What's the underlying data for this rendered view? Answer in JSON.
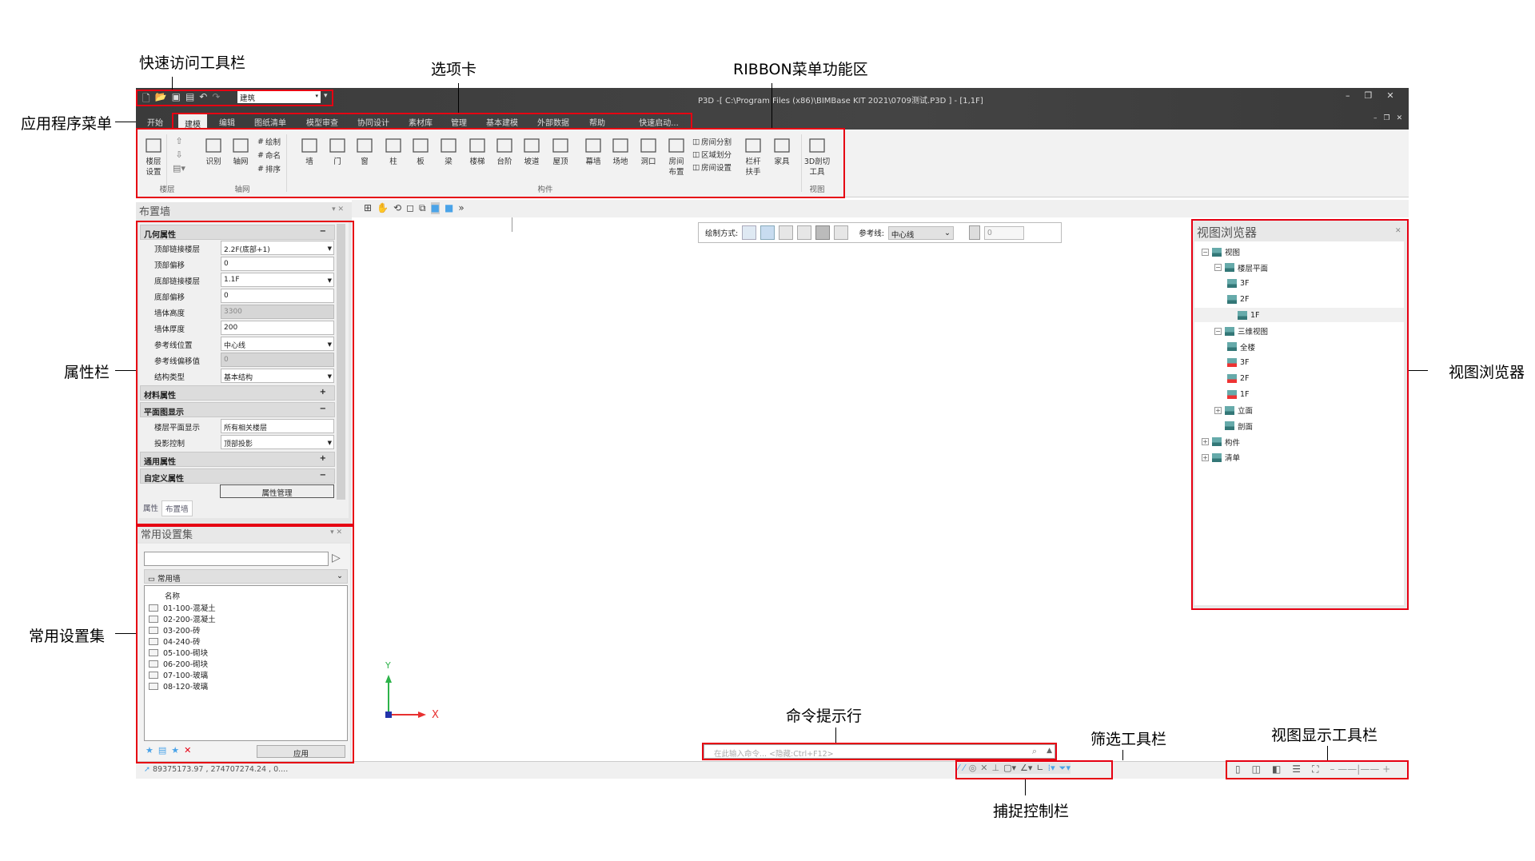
{
  "annotations": {
    "quick_access": "快速访问工具栏",
    "tabs": "选项卡",
    "ribbon": "RIBBON菜单功能区",
    "app_menu": "应用程序菜单",
    "property_bar": "属性栏",
    "common_settings": "常用设置集",
    "view_browser": "视图浏览器",
    "command_line": "命令提示行",
    "filter_toolbar": "筛选工具栏",
    "view_display_toolbar": "视图显示工具栏",
    "snap_bar": "捕捉控制栏"
  },
  "window": {
    "title": "P3D -[ C:\\Program Files (x86)\\BIMBase KIT 2021\\0709测试.P3D ] - [1,1F]",
    "discipline": "建筑"
  },
  "tabs": [
    {
      "label": "开始"
    },
    {
      "label": "建模",
      "active": true
    },
    {
      "label": "编辑"
    },
    {
      "label": "图纸清单"
    },
    {
      "label": "模型审查"
    },
    {
      "label": "协同设计"
    },
    {
      "label": "素材库"
    },
    {
      "label": "管理"
    },
    {
      "label": "基本建模"
    },
    {
      "label": "外部数据"
    },
    {
      "label": "帮助"
    },
    {
      "label": "快速启动..."
    }
  ],
  "ribbon": {
    "groups": [
      "楼层",
      "轴网",
      "构件",
      "视图"
    ],
    "floor": {
      "settings_1": "楼层",
      "settings_2": "设置"
    },
    "grid": {
      "identify": "识别",
      "grid": "轴网",
      "draw": "绘制",
      "name": "命名",
      "sort": "排序"
    },
    "components": [
      "墙",
      "门",
      "窗",
      "柱",
      "板",
      "梁",
      "楼梯",
      "台阶",
      "坡道",
      "屋顶",
      "幕墙",
      "场地",
      "洞口"
    ],
    "room_layout_1": "房间",
    "room_layout_2": "布置",
    "room_small": [
      "房间分割",
      "区域划分",
      "房间设置"
    ],
    "railing_1": "栏杆",
    "railing_2": "扶手",
    "furniture": "家具",
    "section_1": "3D剖切",
    "section_2": "工具"
  },
  "property_panel": {
    "title": "布置墙",
    "sections": {
      "geometry": "几何属性",
      "material": "材料属性",
      "plan": "平面图显示",
      "general": "通用属性",
      "custom": "自定义属性"
    },
    "geometry_rows": [
      {
        "label": "顶部链接楼层",
        "value": "2.2F(底部+1)",
        "dropdown": true
      },
      {
        "label": "顶部偏移",
        "value": "0"
      },
      {
        "label": "底部链接楼层",
        "value": "1.1F",
        "dropdown": true
      },
      {
        "label": "底部偏移",
        "value": "0"
      },
      {
        "label": "墙体高度",
        "value": "3300",
        "disabled": true
      },
      {
        "label": "墙体厚度",
        "value": "200"
      },
      {
        "label": "参考线位置",
        "value": "中心线",
        "dropdown": true
      },
      {
        "label": "参考线偏移值",
        "value": "0",
        "disabled": true
      },
      {
        "label": "结构类型",
        "value": "基本结构",
        "dropdown": true
      }
    ],
    "plan_rows": [
      {
        "label": "楼层平面显示",
        "value": "所有相关楼层"
      },
      {
        "label": "投影控制",
        "value": "顶部投影",
        "dropdown": true
      }
    ],
    "manage_button": "属性管理",
    "bottom_tabs": [
      "属性",
      "布置墙"
    ]
  },
  "common_settings": {
    "title": "常用设置集",
    "search_value": "",
    "category": "常用墙",
    "column": "名称",
    "items": [
      "01-100-混凝土",
      "02-200-混凝土",
      "03-200-砖",
      "04-240-砖",
      "05-100-砌块",
      "06-200-砌块",
      "07-100-玻璃",
      "08-120-玻璃"
    ],
    "apply": "应用"
  },
  "draw_toolbar": {
    "mode_label": "绘制方式:",
    "ref_label": "参考线:",
    "ref_value": "中心线",
    "offset_value": "0"
  },
  "view_browser": {
    "title": "视图浏览器",
    "tree": [
      {
        "label": "视图",
        "level": 0,
        "exp": "−"
      },
      {
        "label": "楼层平面",
        "level": 1,
        "exp": "−"
      },
      {
        "label": "3F",
        "level": 2
      },
      {
        "label": "2F",
        "level": 2
      },
      {
        "label": "1F",
        "level": 2,
        "selected": true
      },
      {
        "label": "三维视图",
        "level": 1,
        "exp": "−"
      },
      {
        "label": "全楼",
        "level": 2
      },
      {
        "label": "3F",
        "level": 2
      },
      {
        "label": "2F",
        "level": 2
      },
      {
        "label": "1F",
        "level": 2
      },
      {
        "label": "立面",
        "level": 1,
        "exp": "+"
      },
      {
        "label": "剖面",
        "level": 1
      },
      {
        "label": "构件",
        "level": 0,
        "exp": "+"
      },
      {
        "label": "清单",
        "level": 0,
        "exp": "+"
      }
    ]
  },
  "command": {
    "placeholder": "在此输入命令... <隐藏:Ctrl+F12>"
  },
  "status": {
    "coords": "89375173.97 , 274707274.24 , 0...."
  },
  "axis": {
    "x": "X",
    "y": "Y"
  },
  "colors": {
    "highlight": "#e60012",
    "titlebar": "#3f3f3f",
    "ribbon": "#f2f2f2",
    "accent_blue": "#4aa3e8"
  }
}
